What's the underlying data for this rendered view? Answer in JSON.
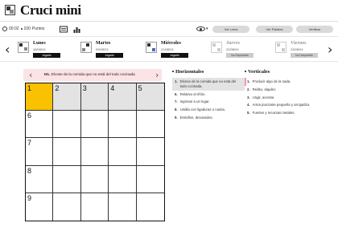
{
  "app": {
    "title": "Cruci mini"
  },
  "toolbar": {
    "timer": "00:02",
    "points": "100",
    "points_label": "Puntos",
    "btn_letter": "Ver Letra",
    "btn_word": "Ver Palabra",
    "btn_verify": "Verificar"
  },
  "days": [
    {
      "name": "Lunes",
      "date": "18/08/24",
      "status": "Jugado"
    },
    {
      "name": "Martes",
      "date": "09/08/24",
      "status": "Jugado"
    },
    {
      "name": "Miércoles",
      "date": "21/08/24",
      "status": "Jugado"
    },
    {
      "name": "Jueves",
      "date": "22/08/24",
      "status": "No Disponible"
    },
    {
      "name": "Viernes",
      "date": "23/08/24",
      "status": "No Disponible"
    }
  ],
  "clue": {
    "id": "H1.",
    "text": "Dícese de la comida que no está del todo cocinada"
  },
  "grid": {
    "numbers": {
      "0": "1",
      "1": "2",
      "2": "3",
      "3": "4",
      "4": "5",
      "5": "6",
      "10": "7",
      "15": "8",
      "20": "9"
    },
    "selected": 0,
    "highlight": [
      1,
      2,
      3,
      4
    ]
  },
  "horizontales": {
    "title": "Horizontales",
    "items": [
      {
        "n": "1.",
        "text": "Dícese de la comida que no está del todo cocinada."
      },
      {
        "n": "6.",
        "text": "Relativo al riñón."
      },
      {
        "n": "7.",
        "text": "Ingresar a un lugar."
      },
      {
        "n": "8.",
        "text": "Unidla con ligaduras o nudos."
      },
      {
        "n": "9.",
        "text": "Estrafios, desusados."
      }
    ]
  },
  "verticales": {
    "title": "Verticales",
    "items": [
      {
        "n": "1.",
        "text": "Producir algo de la nada."
      },
      {
        "n": "2.",
        "text": "Rédito, alquiler."
      },
      {
        "n": "3.",
        "text": "Ungir, acentar."
      },
      {
        "n": "4.",
        "text": "Arma punzante pequeña y arrojadiza."
      },
      {
        "n": "5.",
        "text": "Fuertes y recursas metales."
      }
    ]
  }
}
